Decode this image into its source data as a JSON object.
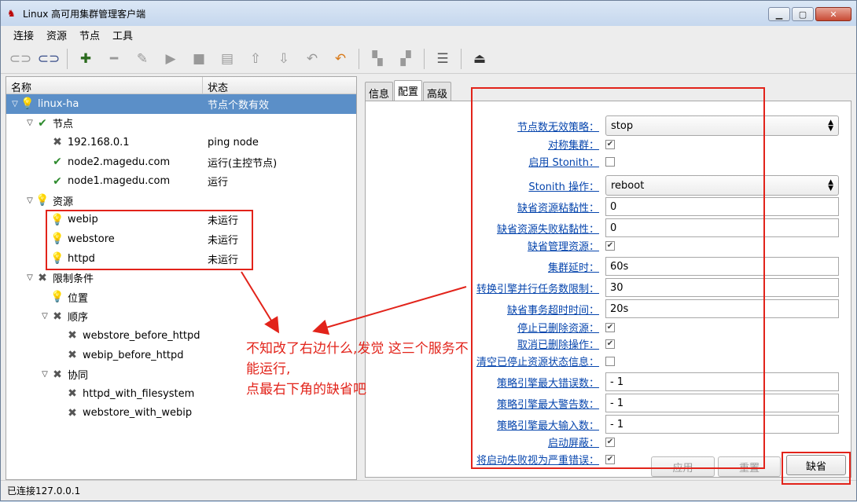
{
  "window": {
    "title": "Linux 高可用集群管理客户端",
    "minimize_icon": "minimize-icon",
    "maximize_icon": "maximize-icon",
    "close_icon": "close-icon"
  },
  "menubar": {
    "items": [
      "连接",
      "资源",
      "节点",
      "工具"
    ]
  },
  "tree": {
    "col_name": "名称",
    "col_status": "状态",
    "rows": [
      {
        "name": "linux-ha",
        "status": "节点个数有效",
        "icon": "bulb-icon",
        "indent": 0,
        "expander": "▽",
        "selected": true
      },
      {
        "name": "节点",
        "status": "",
        "icon": "check-icon",
        "indent": 1,
        "expander": "▽"
      },
      {
        "name": "192.168.0.1",
        "status": "ping node",
        "icon": "tools-icon",
        "indent": 2,
        "expander": ""
      },
      {
        "name": "node2.magedu.com",
        "status": "运行(主控节点)",
        "icon": "check-icon",
        "indent": 2,
        "expander": ""
      },
      {
        "name": "node1.magedu.com",
        "status": "运行",
        "icon": "check-icon",
        "indent": 2,
        "expander": ""
      },
      {
        "name": "资源",
        "status": "",
        "icon": "bulb-icon",
        "indent": 1,
        "expander": "▽"
      },
      {
        "name": "webip",
        "status": "未运行",
        "icon": "bulb-icon",
        "indent": 2,
        "expander": ""
      },
      {
        "name": "webstore",
        "status": "未运行",
        "icon": "bulb-icon",
        "indent": 2,
        "expander": ""
      },
      {
        "name": "httpd",
        "status": "未运行",
        "icon": "bulb-icon",
        "indent": 2,
        "expander": ""
      },
      {
        "name": "限制条件",
        "status": "",
        "icon": "tools-icon",
        "indent": 1,
        "expander": "▽"
      },
      {
        "name": "位置",
        "status": "",
        "icon": "bulb-icon",
        "indent": 2,
        "expander": ""
      },
      {
        "name": "顺序",
        "status": "",
        "icon": "tools-icon",
        "indent": 2,
        "expander": "▽"
      },
      {
        "name": "webstore_before_httpd",
        "status": "",
        "icon": "tools-icon",
        "indent": 3,
        "expander": ""
      },
      {
        "name": "webip_before_httpd",
        "status": "",
        "icon": "tools-icon",
        "indent": 3,
        "expander": ""
      },
      {
        "name": "协同",
        "status": "",
        "icon": "tools-icon",
        "indent": 2,
        "expander": "▽"
      },
      {
        "name": "httpd_with_filesystem",
        "status": "",
        "icon": "tools-icon",
        "indent": 3,
        "expander": ""
      },
      {
        "name": "webstore_with_webip",
        "status": "",
        "icon": "tools-icon",
        "indent": 3,
        "expander": ""
      }
    ]
  },
  "tabs": [
    "信息",
    "配置",
    "高级"
  ],
  "config": {
    "rows": [
      {
        "label": "节点数无效策略：",
        "type": "combo",
        "value": "stop"
      },
      {
        "label": "对称集群：",
        "type": "checkbox",
        "checked": true
      },
      {
        "label": "启用 Stonith：",
        "type": "checkbox",
        "checked": false
      },
      {
        "label": "Stonith 操作：",
        "type": "combo",
        "value": "reboot"
      },
      {
        "label": "缺省资源粘黏性：",
        "type": "text",
        "value": "0"
      },
      {
        "label": "缺省资源失败粘黏性：",
        "type": "text",
        "value": "0"
      },
      {
        "label": "缺省管理资源：",
        "type": "checkbox",
        "checked": true
      },
      {
        "label": "集群延时：",
        "type": "text",
        "value": "60s"
      },
      {
        "label": "转换引擎并行任务数限制：",
        "type": "text",
        "value": "30"
      },
      {
        "label": "缺省事务超时时间：",
        "type": "text",
        "value": "20s"
      },
      {
        "label": "停止已删除资源：",
        "type": "checkbox",
        "checked": true
      },
      {
        "label": "取消已删除操作：",
        "type": "checkbox",
        "checked": true
      },
      {
        "label": "清空已停止资源状态信息：",
        "type": "checkbox",
        "checked": false
      },
      {
        "label": "策略引擎最大错误数：",
        "type": "text",
        "value": "- 1"
      },
      {
        "label": "策略引擎最大警告数：",
        "type": "text",
        "value": "- 1"
      },
      {
        "label": "策略引擎最大输入数：",
        "type": "text",
        "value": "- 1"
      },
      {
        "label": "启动屏蔽：",
        "type": "checkbox",
        "checked": true
      },
      {
        "label": "将启动失败视为严重错误：",
        "type": "checkbox",
        "checked": true
      }
    ]
  },
  "buttons": {
    "apply": "应用",
    "reset": "重置",
    "default": "缺省"
  },
  "statusbar": {
    "text": "已连接127.0.0.1"
  },
  "annotation": {
    "line1": "不知改了右边什么,发觉 这三个服务不能运行,",
    "line2": "点最右下角的缺省吧"
  },
  "colors": {
    "annotation_red": "#e2231a",
    "selection_blue": "#5b8fc8",
    "link_blue": "#0645ad"
  }
}
